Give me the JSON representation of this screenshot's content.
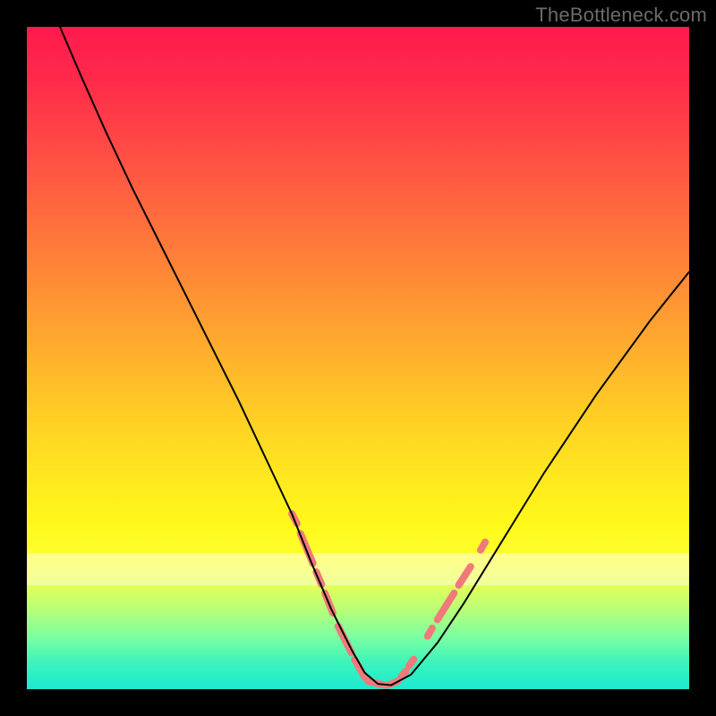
{
  "watermark": "TheBottleneck.com",
  "chart_data": {
    "type": "line",
    "title": "",
    "xlabel": "",
    "ylabel": "",
    "xlim": [
      0,
      100
    ],
    "ylim": [
      0,
      100
    ],
    "grid": false,
    "series": [
      {
        "name": "curve",
        "color": "#000000",
        "x": [
          5,
          8,
          12,
          16,
          20,
          24,
          28,
          32,
          36,
          40,
          43,
          46,
          49,
          51,
          53,
          55,
          58,
          62,
          66,
          70,
          74,
          78,
          82,
          86,
          90,
          94,
          98,
          100
        ],
        "y": [
          100,
          93,
          84,
          75.5,
          67.5,
          59.5,
          51.5,
          43.5,
          35,
          26.5,
          19,
          12,
          6,
          2.5,
          0.8,
          0.6,
          2.2,
          7,
          13,
          19.5,
          26,
          32.5,
          38.5,
          44.5,
          50,
          55.5,
          60.5,
          63
        ]
      }
    ],
    "highlight_segments": {
      "color": "#ef7a7a",
      "description": "thick salmon segments overlaid on lower part of curve",
      "segments": [
        {
          "x1": 40.0,
          "y1": 26.5,
          "x2": 40.8,
          "y2": 25.0
        },
        {
          "x1": 41.3,
          "y1": 23.5,
          "x2": 43.2,
          "y2": 19.0
        },
        {
          "x1": 43.7,
          "y1": 17.7,
          "x2": 44.5,
          "y2": 15.8
        },
        {
          "x1": 45.0,
          "y1": 14.5,
          "x2": 46.2,
          "y2": 11.5
        },
        {
          "x1": 47.0,
          "y1": 9.5,
          "x2": 49.0,
          "y2": 5.5
        },
        {
          "x1": 49.5,
          "y1": 4.5,
          "x2": 51.0,
          "y2": 1.8
        },
        {
          "x1": 51.5,
          "y1": 1.2,
          "x2": 54.0,
          "y2": 0.6
        },
        {
          "x1": 54.5,
          "y1": 0.6,
          "x2": 56.0,
          "y2": 1.2
        },
        {
          "x1": 56.5,
          "y1": 1.8,
          "x2": 57.2,
          "y2": 2.7
        },
        {
          "x1": 57.7,
          "y1": 3.5,
          "x2": 58.4,
          "y2": 4.5
        },
        {
          "x1": 60.5,
          "y1": 8.0,
          "x2": 61.2,
          "y2": 9.2
        },
        {
          "x1": 62.0,
          "y1": 10.5,
          "x2": 64.5,
          "y2": 14.5
        },
        {
          "x1": 65.2,
          "y1": 15.7,
          "x2": 67.0,
          "y2": 18.5
        },
        {
          "x1": 68.5,
          "y1": 21.0,
          "x2": 69.2,
          "y2": 22.2
        }
      ]
    }
  }
}
